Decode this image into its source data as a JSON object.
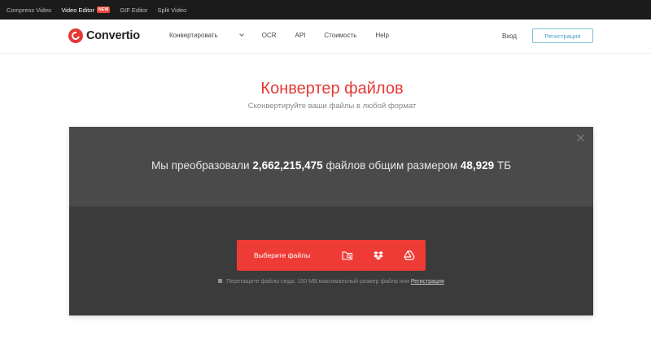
{
  "topbar": {
    "links": [
      "Compress Video",
      "Video Editor",
      "GIF Editor",
      "Split Video"
    ],
    "new_badge": "NEW"
  },
  "header": {
    "logo_text": "Convertio",
    "nav": [
      "Конвертировать",
      "OCR",
      "API",
      "Стоимость",
      "Help"
    ],
    "login": "Вход",
    "register": "Регистрация"
  },
  "hero": {
    "title": "Конвертер файлов",
    "subtitle": "Сконвертируйте ваши файлы в любой формат"
  },
  "panel": {
    "stats_prefix": "Мы преобразовали",
    "files_count": "2,662,215,475",
    "stats_middle": "файлов общим размером",
    "total_size": "48,929",
    "size_unit": "ТБ",
    "choose_label": "Выберите файлы",
    "note_text": "Перетащите файлы сюда. 100 MB максимальный размер файла или",
    "note_link": "Регистрация"
  },
  "icons": {
    "folder": "folder-search-icon",
    "dropbox": "dropbox-icon",
    "drive": "google-drive-icon"
  },
  "colors": {
    "accent": "#e53935",
    "button": "#ef3b36",
    "panel_dark": "#3b3b3b",
    "panel_top": "#4a4a4a",
    "register_border": "#7fc1d8"
  }
}
